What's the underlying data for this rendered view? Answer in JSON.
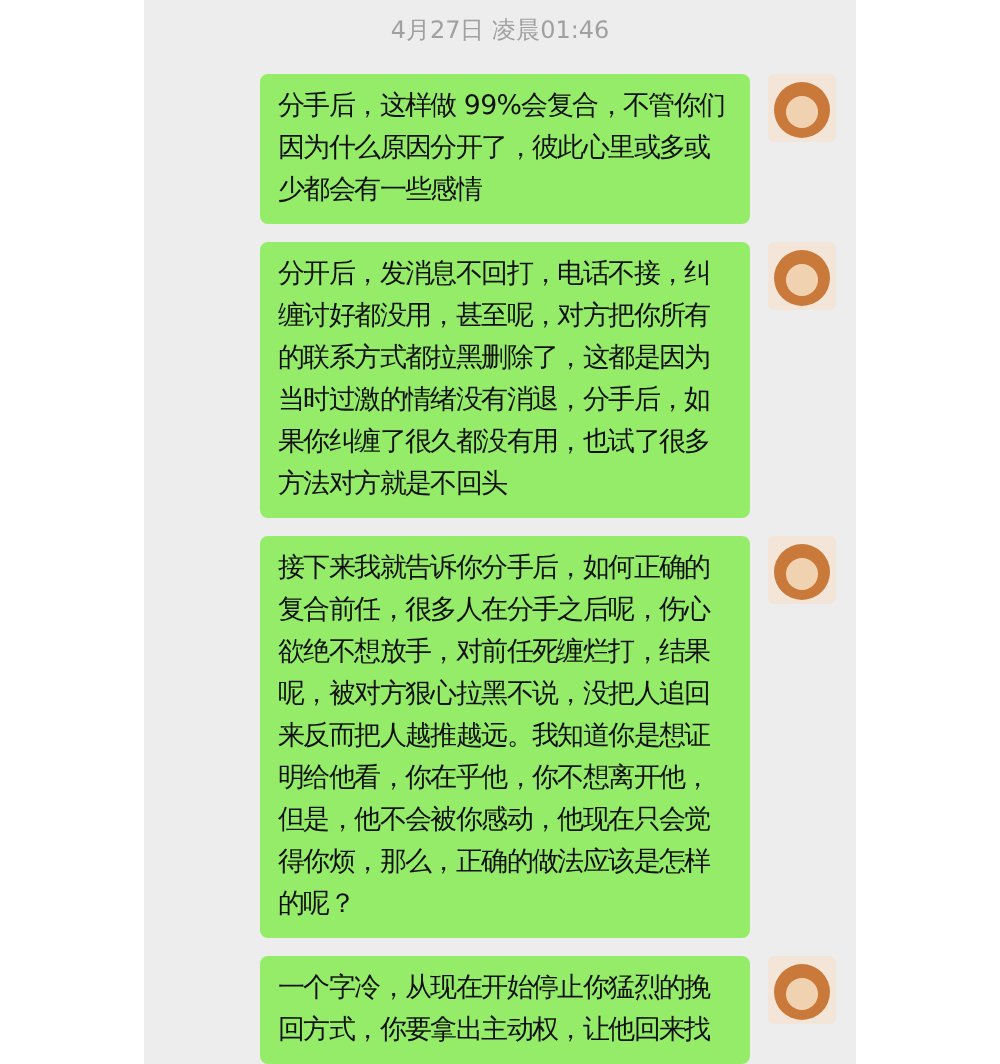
{
  "timestamp": "4月27日 凌晨01:46",
  "messages": [
    {
      "text": "分手后，这样做 99%会复合，不管你们因为什么原因分开了，彼此心里或多或少都会有一些感情"
    },
    {
      "text": "分开后，发消息不回打，电话不接，纠缠讨好都没用，甚至呢，对方把你所有的联系方式都拉黑删除了，这都是因为当时过激的情绪没有消退，分手后，如果你纠缠了很久都没有用，也试了很多方法对方就是不回头"
    },
    {
      "text": "接下来我就告诉你分手后，如何正确的复合前任，很多人在分手之后呢，伤心欲绝不想放手，对前任死缠烂打，结果呢，被对方狠心拉黑不说，没把人追回来反而把人越推越远。我知道你是想证明给他看，你在乎他，你不想离开他，但是，他不会被你感动，他现在只会觉得你烦，那么，正确的做法应该是怎样的呢？"
    },
    {
      "text": "一个字冷，从现在开始停止你猛烈的挽回方式，你要拿出主动权，让他回来找"
    }
  ]
}
